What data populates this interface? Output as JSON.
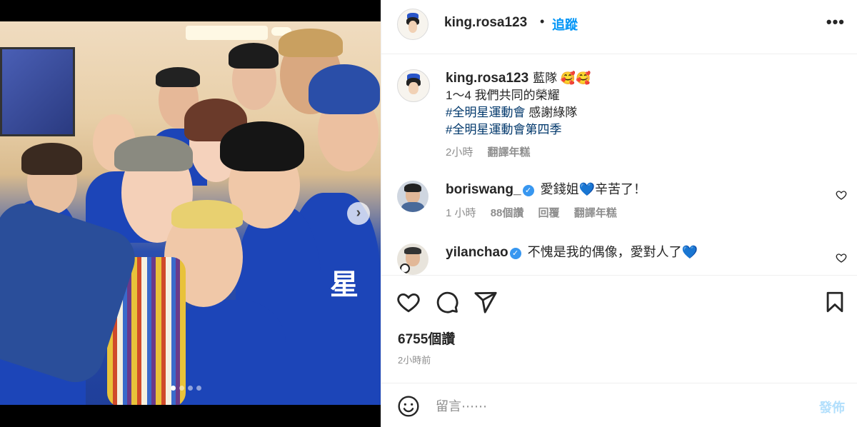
{
  "post": {
    "username": "king.rosa123",
    "follow_label": "追蹤",
    "separator": "•",
    "more_label": "•••"
  },
  "media": {
    "total_slides": 4,
    "current_slide": 1,
    "next_glyph": "›",
    "jersey_text": "星"
  },
  "caption": {
    "username": "king.rosa123",
    "line1": "藍隊 🥰🥰",
    "line2": "1～4 我們共同的榮耀",
    "hashtag1": "#全明星運動會",
    "line3_rest": " 感謝綠隊",
    "hashtag2": "#全明星運動會第四季",
    "time": "2小時",
    "translate": "翻譯年糕"
  },
  "comments": [
    {
      "username": "boriswang_",
      "verified": true,
      "text": " 愛錢姐💙辛苦了！",
      "time": "1 小時",
      "likes": "88個讚",
      "reply": "回覆",
      "translate": "翻譯年糕"
    },
    {
      "username": "yilanchao",
      "verified": true,
      "text": " 不愧是我的偶像，愛對人了💙"
    }
  ],
  "actions": {
    "likes_count": "6755個讚",
    "posted_time": "2小時前"
  },
  "composer": {
    "placeholder": "留言⋯⋯",
    "post_label": "發佈"
  },
  "colors": {
    "link_blue": "#0095f6",
    "hashtag": "#00376b",
    "muted": "#8e8e8e",
    "post_disabled": "#b2dffc"
  }
}
